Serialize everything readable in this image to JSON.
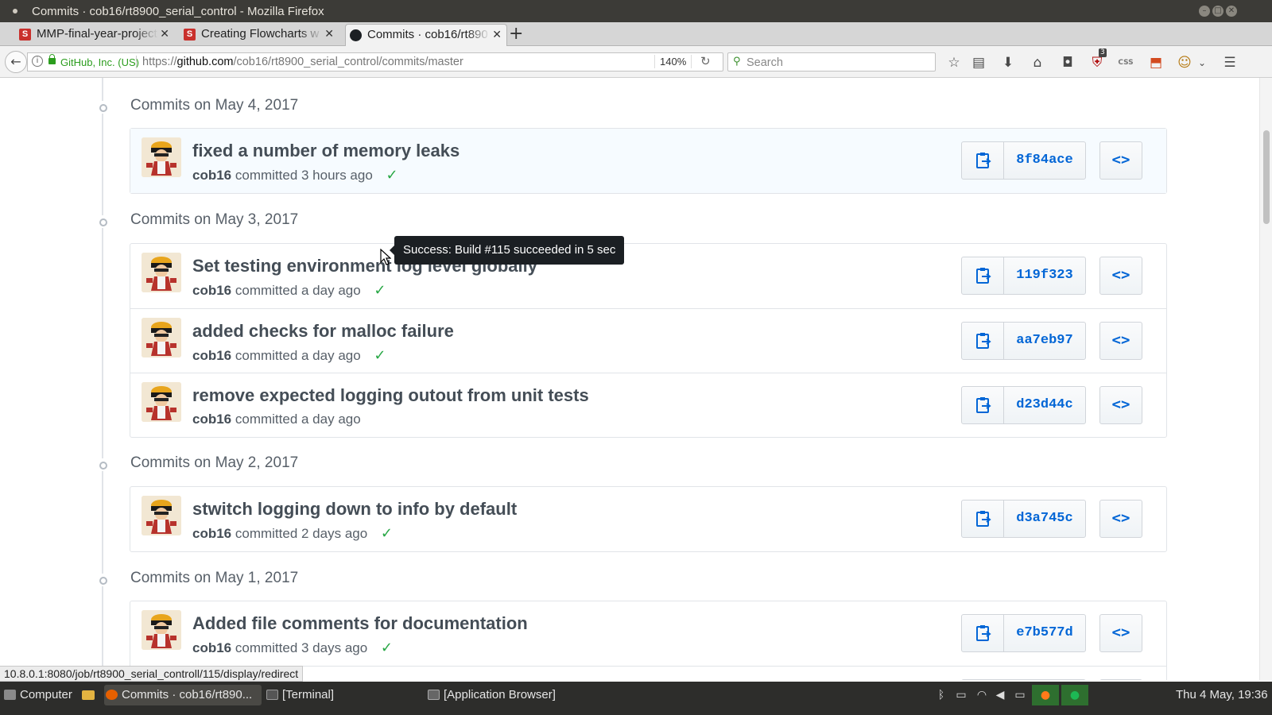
{
  "window": {
    "title": "Commits · cob16/rt8900_serial_control - Mozilla Firefox"
  },
  "tabs": [
    {
      "label": "MMP-final-year-project",
      "icon": "scribd-favicon",
      "close": "✕"
    },
    {
      "label": "Creating Flowcharts w",
      "icon": "scribd-favicon",
      "close": "✕"
    },
    {
      "label": "Commits · cob16/rt890",
      "icon": "github-favicon",
      "close": "✕",
      "active": true
    }
  ],
  "new_tab_label": "+",
  "favicon_letter": "S",
  "navbar": {
    "site_identity": "GitHub, Inc. (US)",
    "url_prefix": "https://",
    "url_domain": "github.com",
    "url_path": "/cob16/rt8900_serial_control/commits/master",
    "zoom": "140%",
    "search_placeholder": "Search",
    "addon_badge": "3",
    "css_label": "CSS"
  },
  "days": [
    {
      "heading": "Commits on May 4, 2017",
      "commits": [
        {
          "message": "fixed a number of memory leaks",
          "author": "cob16",
          "committed": "committed 3 hours ago",
          "status": "success",
          "sha": "8f84ace",
          "highlighted": true
        }
      ]
    },
    {
      "heading": "Commits on May 3, 2017",
      "commits": [
        {
          "message": "Set testing environment log level globally",
          "author": "cob16",
          "committed": "committed a day ago",
          "status": "success",
          "sha": "119f323"
        },
        {
          "message": "added checks for malloc failure",
          "author": "cob16",
          "committed": "committed a day ago",
          "status": "success",
          "sha": "aa7eb97"
        },
        {
          "message": "remove expected logging outout from unit tests",
          "author": "cob16",
          "committed": "committed a day ago",
          "status": "",
          "sha": "d23d44c"
        }
      ]
    },
    {
      "heading": "Commits on May 2, 2017",
      "commits": [
        {
          "message": "stwitch logging down to info by default",
          "author": "cob16",
          "committed": "committed 2 days ago",
          "status": "success",
          "sha": "d3a745c"
        }
      ]
    },
    {
      "heading": "Commits on May 1, 2017",
      "commits": [
        {
          "message": "Added file comments for documentation",
          "author": "cob16",
          "committed": "committed 3 days ago",
          "status": "success",
          "sha": "e7b577d"
        }
      ]
    }
  ],
  "check_glyph": "✓",
  "browse_glyph": "<>",
  "tooltip": "Success: Build #115 succeeded in 5 sec",
  "status_url": "10.8.0.1:8080/job/rt8900_serial_controll/115/display/redirect",
  "taskbar": {
    "items": [
      {
        "label": "Computer"
      },
      {
        "label": "Commits · cob16/rt890..."
      },
      {
        "label": "[Terminal]"
      },
      {
        "label": "[Application Browser]"
      }
    ],
    "clock": "Thu 4 May, 19:36"
  },
  "colors": {
    "link": "#0366d6",
    "success": "#28a745",
    "tooltip_bg": "#1b1f23",
    "taskbar_bg": "#2d2d2b"
  }
}
